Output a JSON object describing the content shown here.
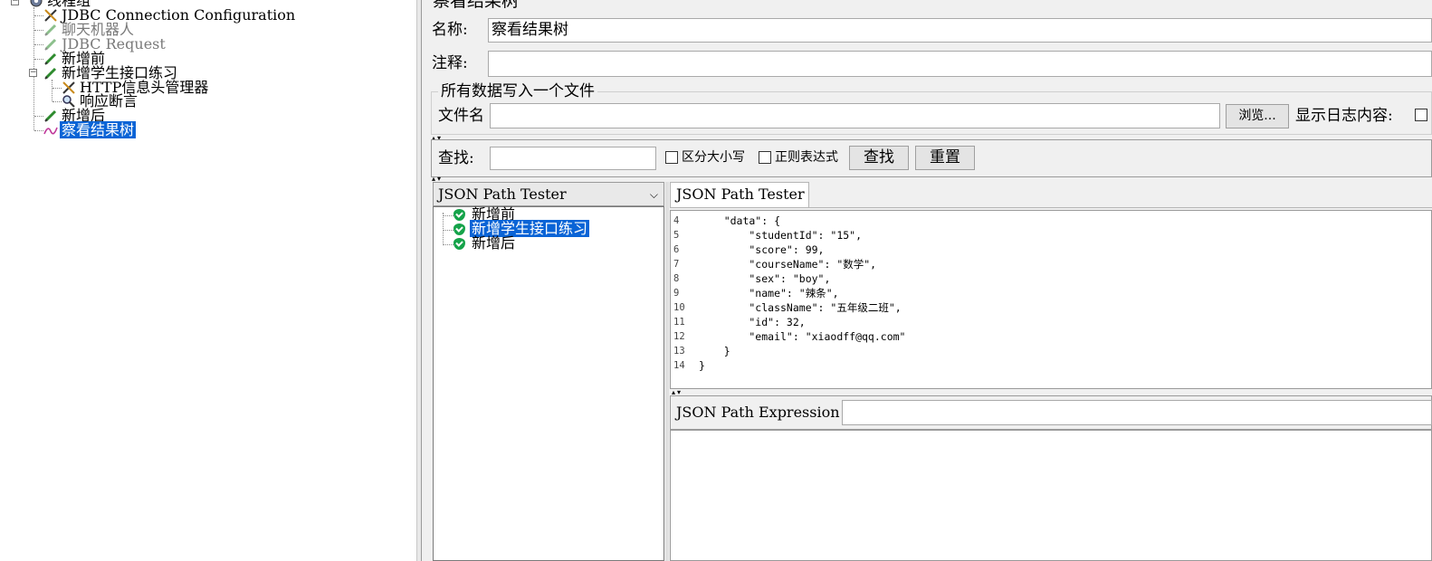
{
  "tree": {
    "items": [
      {
        "label": "线程组",
        "icon": "thread-group-icon"
      },
      {
        "label": "JDBC Connection Configuration",
        "icon": "wrench-icon"
      },
      {
        "label": "聊天机器人",
        "icon": "pencil-icon"
      },
      {
        "label": "JDBC Request",
        "icon": "pencil-icon"
      },
      {
        "label": "新增前",
        "icon": "pencil-icon"
      },
      {
        "label": "新增学生接口练习",
        "icon": "pencil-icon"
      },
      {
        "label": "HTTP信息头管理器",
        "icon": "wrench-icon"
      },
      {
        "label": "响应断言",
        "icon": "magnifier-icon"
      },
      {
        "label": "新增后",
        "icon": "pencil-icon"
      },
      {
        "label": "察看结果树",
        "icon": "graph-icon"
      }
    ]
  },
  "panel": {
    "title": "察看结果树",
    "name_label": "名称:",
    "name_value": "察看结果树",
    "comment_label": "注释:",
    "comment_value": "",
    "file_group_title": "所有数据写入一个文件",
    "filename_label": "文件名",
    "filename_value": "",
    "browse_button": "浏览...",
    "log_label": "显示日志内容:"
  },
  "search": {
    "label": "查找:",
    "value": "",
    "case_label": "区分大小写",
    "regex_label": "正则表达式",
    "find_button": "查找",
    "reset_button": "重置"
  },
  "renderer": {
    "selected": "JSON Path Tester",
    "results": [
      {
        "label": "新增前",
        "status": "success"
      },
      {
        "label": "新增学生接口练习",
        "status": "success"
      },
      {
        "label": "新增后",
        "status": "success"
      }
    ]
  },
  "tester": {
    "tab_label": "JSON Path Tester",
    "expression_label": "JSON Path Expression",
    "expression_value": "",
    "code": [
      {
        "n": "4",
        "text": "    \"data\": {"
      },
      {
        "n": "5",
        "text": "        \"studentId\": \"15\","
      },
      {
        "n": "6",
        "text": "        \"score\": 99,"
      },
      {
        "n": "7",
        "text": "        \"courseName\": \"数学\","
      },
      {
        "n": "8",
        "text": "        \"sex\": \"boy\","
      },
      {
        "n": "9",
        "text": "        \"name\": \"辣条\","
      },
      {
        "n": "10",
        "text": "        \"className\": \"五年级二班\","
      },
      {
        "n": "11",
        "text": "        \"id\": 32,"
      },
      {
        "n": "12",
        "text": "        \"email\": \"xiaodff@qq.com\""
      },
      {
        "n": "13",
        "text": "    }"
      },
      {
        "n": "14",
        "text": "}"
      }
    ]
  },
  "colors": {
    "selection": "#0a64d6",
    "success": "#15a34a"
  }
}
